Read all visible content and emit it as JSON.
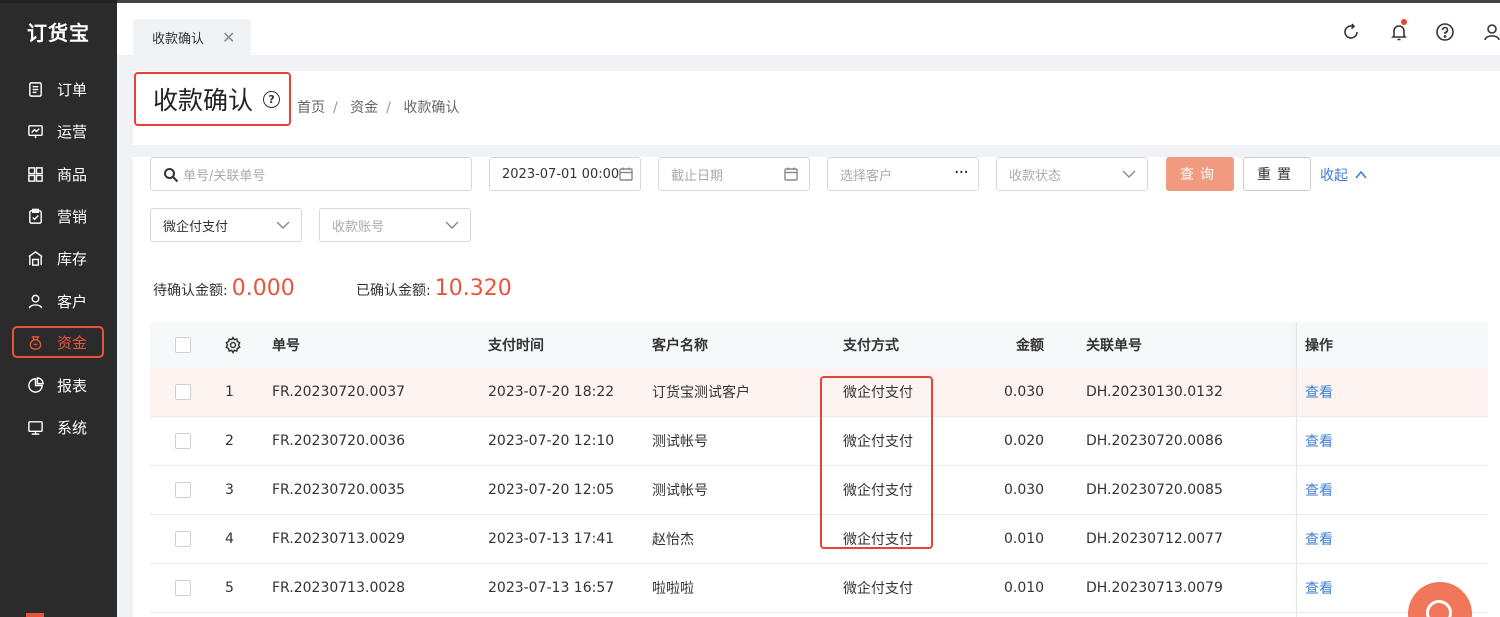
{
  "app": {
    "logo": "订货宝"
  },
  "sidebar": {
    "items": [
      {
        "label": "订单",
        "icon": "document-icon"
      },
      {
        "label": "运营",
        "icon": "chart-board-icon"
      },
      {
        "label": "商品",
        "icon": "grid-icon"
      },
      {
        "label": "营销",
        "icon": "clipboard-check-icon"
      },
      {
        "label": "库存",
        "icon": "warehouse-icon"
      },
      {
        "label": "客户",
        "icon": "user-icon"
      },
      {
        "label": "资金",
        "icon": "money-bag-icon",
        "active": true
      },
      {
        "label": "报表",
        "icon": "pie-chart-icon"
      },
      {
        "label": "系统",
        "icon": "monitor-icon"
      }
    ]
  },
  "topbar": {
    "tab_label": "收款确认",
    "icons": [
      "refresh-icon",
      "bell-icon",
      "help-icon",
      "user-icon"
    ]
  },
  "page": {
    "title": "收款确认",
    "breadcrumb": [
      "首页",
      "资金",
      "收款确认"
    ]
  },
  "filters": {
    "order_no_placeholder": "单号/关联单号",
    "start_date_value": "2023-07-01 00:00",
    "end_date_placeholder": "截止日期",
    "customer_placeholder": "选择客户",
    "status_placeholder": "收款状态",
    "pay_method_value": "微企付支付",
    "account_placeholder": "收款账号",
    "query_label": "查询",
    "reset_label": "重置",
    "collapse_label": "收起"
  },
  "summary": {
    "pending_label": "待确认金额:",
    "pending_amount": "0.000",
    "confirmed_label": "已确认金额:",
    "confirmed_amount": "10.320"
  },
  "table": {
    "columns": [
      "单号",
      "支付时间",
      "客户名称",
      "支付方式",
      "金额",
      "关联单号",
      "操作"
    ],
    "rows": [
      {
        "idx": "1",
        "no": "FR.20230720.0037",
        "time": "2023-07-20 18:22",
        "customer": "订货宝测试客户",
        "method": "微企付支付",
        "amount": "0.030",
        "related": "DH.20230130.0132",
        "op": "查看"
      },
      {
        "idx": "2",
        "no": "FR.20230720.0036",
        "time": "2023-07-20 12:10",
        "customer": "测试帐号",
        "method": "微企付支付",
        "amount": "0.020",
        "related": "DH.20230720.0086",
        "op": "查看"
      },
      {
        "idx": "3",
        "no": "FR.20230720.0035",
        "time": "2023-07-20 12:05",
        "customer": "测试帐号",
        "method": "微企付支付",
        "amount": "0.030",
        "related": "DH.20230720.0085",
        "op": "查看"
      },
      {
        "idx": "4",
        "no": "FR.20230713.0029",
        "time": "2023-07-13 17:41",
        "customer": "赵怡杰",
        "method": "微企付支付",
        "amount": "0.010",
        "related": "DH.20230712.0077",
        "op": "查看"
      },
      {
        "idx": "5",
        "no": "FR.20230713.0028",
        "time": "2023-07-13 16:57",
        "customer": "啦啦啦",
        "method": "微企付支付",
        "amount": "0.010",
        "related": "DH.20230713.0079",
        "op": "查看"
      }
    ]
  }
}
